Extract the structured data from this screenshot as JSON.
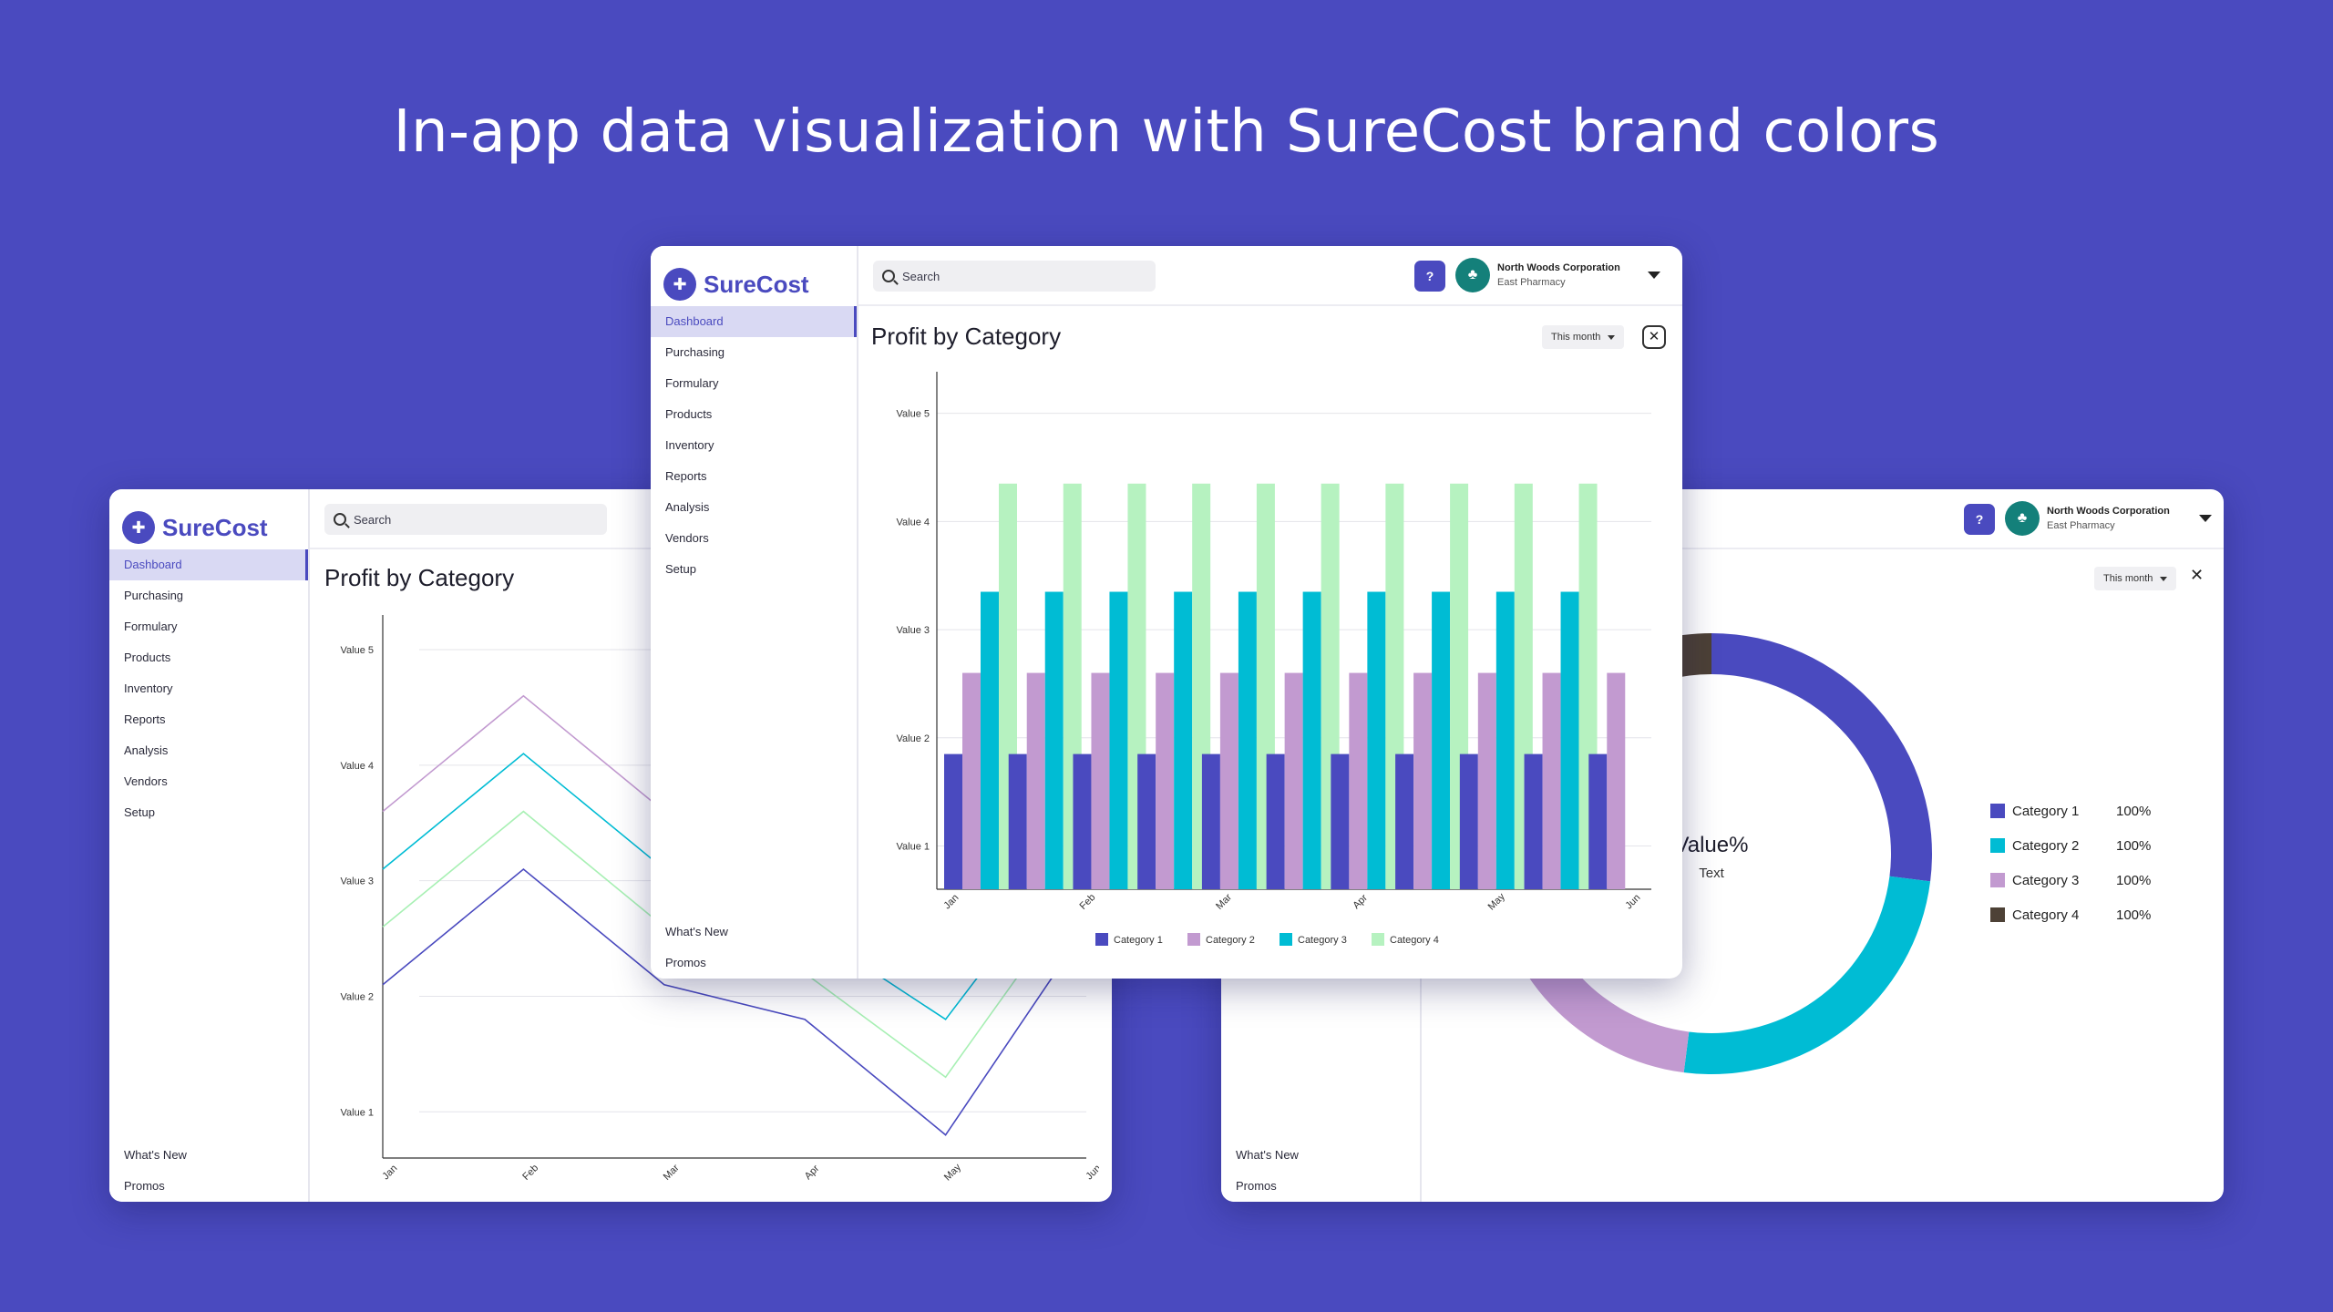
{
  "headline": "In-app data visualization with SureCost brand colors",
  "brand": {
    "name": "SureCost",
    "colors": {
      "primary": "#4a4abf",
      "cat1": "#4a4abf",
      "cat2_bar": "#c29ad0",
      "cat3_bar": "#00bcd4",
      "cat4_bar": "#b6f2c0",
      "cat5": "#4d4136"
    }
  },
  "sidebar": {
    "items": [
      "Dashboard",
      "Purchasing",
      "Formulary",
      "Products",
      "Inventory",
      "Reports",
      "Analysis",
      "Vendors",
      "Setup"
    ],
    "bottom": [
      "What's New",
      "Promos"
    ],
    "active_index": 0
  },
  "search": {
    "placeholder": "Search"
  },
  "org": {
    "name": "North Woods Corporation",
    "location": "East Pharmacy"
  },
  "help_label": "?",
  "panel": {
    "title": "Profit by Category",
    "period": "This month",
    "close": "✕"
  },
  "donut_center": {
    "value": "Value%",
    "sub": "Text"
  },
  "chart_data": [
    {
      "type": "bar",
      "window": "front",
      "title": "Profit by Category",
      "categories": [
        "Jan",
        "",
        "Feb",
        "",
        "Mar",
        "",
        "Apr",
        "",
        "May",
        "",
        "Jun"
      ],
      "x_tick_labels": [
        "Jan",
        "Feb",
        "Mar",
        "Apr",
        "May",
        "Jun"
      ],
      "y_tick_labels": [
        "Value 1",
        "Value 2",
        "Value 3",
        "Value 4",
        "Value 5"
      ],
      "ylim": [
        0.6,
        5.3
      ],
      "grid": true,
      "legend": "bottom",
      "series": [
        {
          "name": "Category 1",
          "color": "#4a4abf",
          "values": [
            1.85,
            1.85,
            1.85,
            1.85,
            1.85,
            1.85,
            1.85,
            1.85,
            1.85,
            1.85,
            1.85
          ]
        },
        {
          "name": "Category 2",
          "color": "#c29ad0",
          "values": [
            2.6,
            2.6,
            2.6,
            2.6,
            2.6,
            2.6,
            2.6,
            2.6,
            2.6,
            2.6,
            2.6
          ]
        },
        {
          "name": "Category 3",
          "color": "#00bcd4",
          "values": [
            3.35,
            3.35,
            3.35,
            3.35,
            3.35,
            3.35,
            3.35,
            3.35,
            3.35,
            3.35,
            0
          ]
        },
        {
          "name": "Category 4",
          "color": "#b6f2c0",
          "values": [
            4.35,
            4.35,
            4.35,
            4.35,
            4.35,
            4.35,
            4.35,
            4.35,
            4.35,
            4.35,
            0
          ]
        }
      ]
    },
    {
      "type": "line",
      "window": "left",
      "title": "Profit by Category",
      "x": [
        "Jan",
        "Feb",
        "Mar",
        "Apr",
        "May",
        "Jun"
      ],
      "y_tick_labels": [
        "Value 1",
        "Value 2",
        "Value 3",
        "Value 4",
        "Value 5"
      ],
      "ylim": [
        0.6,
        5.3
      ],
      "grid": true,
      "legend": "bottom",
      "series": [
        {
          "name": "Category 1",
          "color": "#4a4abf",
          "values": [
            2.1,
            3.1,
            2.1,
            1.8,
            0.8,
            2.6
          ]
        },
        {
          "name": "Category 2",
          "color": "#a8f0b4",
          "values": [
            2.6,
            3.6,
            2.6,
            2.2,
            1.3,
            3.0
          ]
        },
        {
          "name": "Category 3",
          "color": "#00bcd4",
          "values": [
            3.1,
            4.1,
            3.1,
            2.6,
            1.8,
            3.4
          ]
        },
        {
          "name": "Category 4",
          "color": "#c29ad0",
          "values": [
            3.6,
            4.6,
            3.6,
            3.0,
            2.3,
            3.8
          ]
        }
      ]
    },
    {
      "type": "pie",
      "window": "right",
      "slices": [
        {
          "name": "Category 1",
          "label": "100%",
          "value": 0.27,
          "color": "#4a4abf"
        },
        {
          "name": "Category 2",
          "label": "100%",
          "value": 0.25,
          "color": "#00bcd4"
        },
        {
          "name": "Category 3",
          "label": "100%",
          "value": 0.44,
          "color": "#c29ad0"
        },
        {
          "name": "Category 4",
          "label": "100%",
          "value": 0.04,
          "color": "#4d4136"
        }
      ],
      "legend": "right"
    }
  ]
}
